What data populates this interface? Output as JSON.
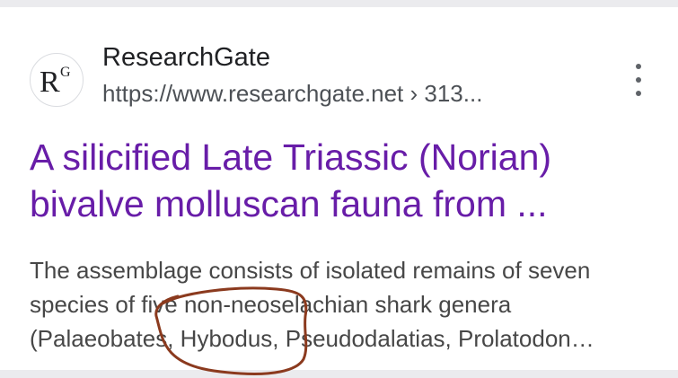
{
  "result": {
    "favicon_label": "RG",
    "site_name": "ResearchGate",
    "url": "https://www.researchgate.net › 313...",
    "title_lines": [
      "A silicified Late Triassic (Norian)",
      "bivalve molluscan fauna from ..."
    ],
    "snippet_lines": [
      "The assemblage consists of isolated remains of seven",
      "species of five non-neoselachian shark genera",
      "(Palaeobates, Hybodus, Pseudodalatias, Prolatodon…"
    ],
    "more_icon": "more-vertical-icon"
  },
  "colors": {
    "title": "#681da8",
    "annotation": "#8b3a1e"
  }
}
